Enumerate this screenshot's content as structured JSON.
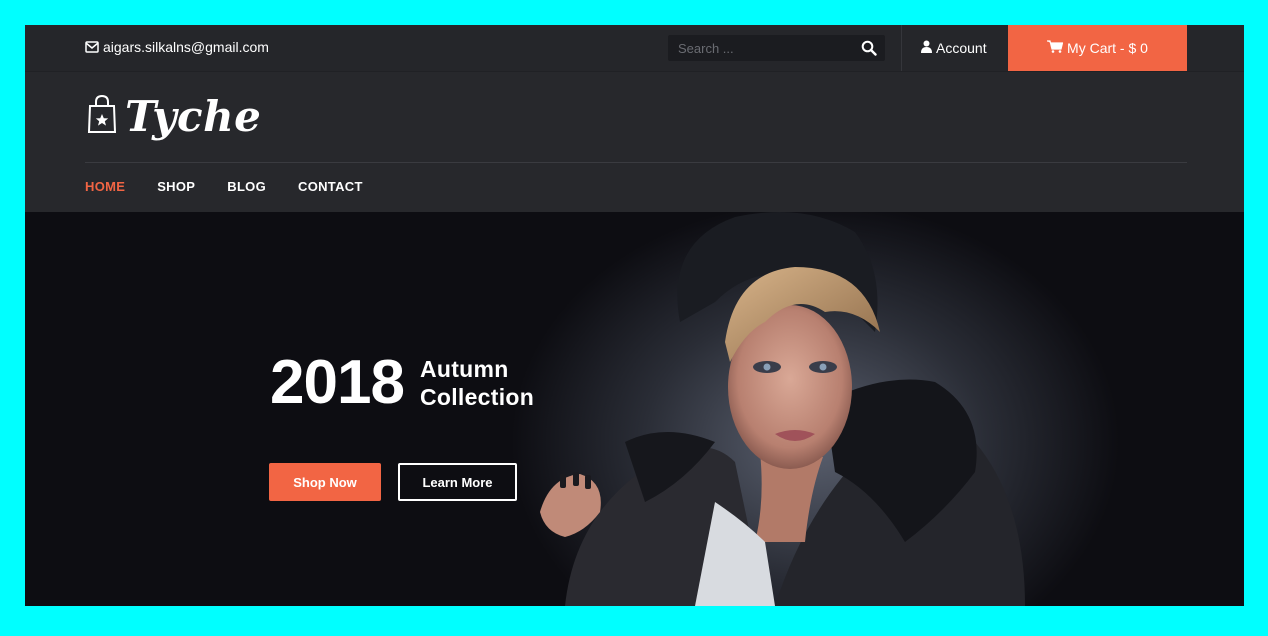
{
  "topbar": {
    "email": "aigars.silkalns@gmail.com",
    "email_icon": "envelope-icon",
    "search_placeholder": "Search ...",
    "search_icon": "search-icon",
    "account_label": "Account",
    "account_icon": "user-icon",
    "cart_label": "My Cart - $ 0",
    "cart_icon": "cart-icon"
  },
  "header": {
    "logo_text": "Tyche",
    "logo_icon": "shopping-bag-icon"
  },
  "nav": {
    "items": [
      {
        "label": "HOME",
        "active": true
      },
      {
        "label": "SHOP",
        "active": false
      },
      {
        "label": "BLOG",
        "active": false
      },
      {
        "label": "CONTACT",
        "active": false
      }
    ]
  },
  "hero": {
    "year": "2018",
    "subtitle_line1": "Autumn",
    "subtitle_line2": "Collection",
    "primary_button": "Shop Now",
    "secondary_button": "Learn More"
  },
  "colors": {
    "accent": "#f26544",
    "topbar_bg": "#25262a",
    "header_bg": "#27282c",
    "page_border": "#00ffff"
  }
}
